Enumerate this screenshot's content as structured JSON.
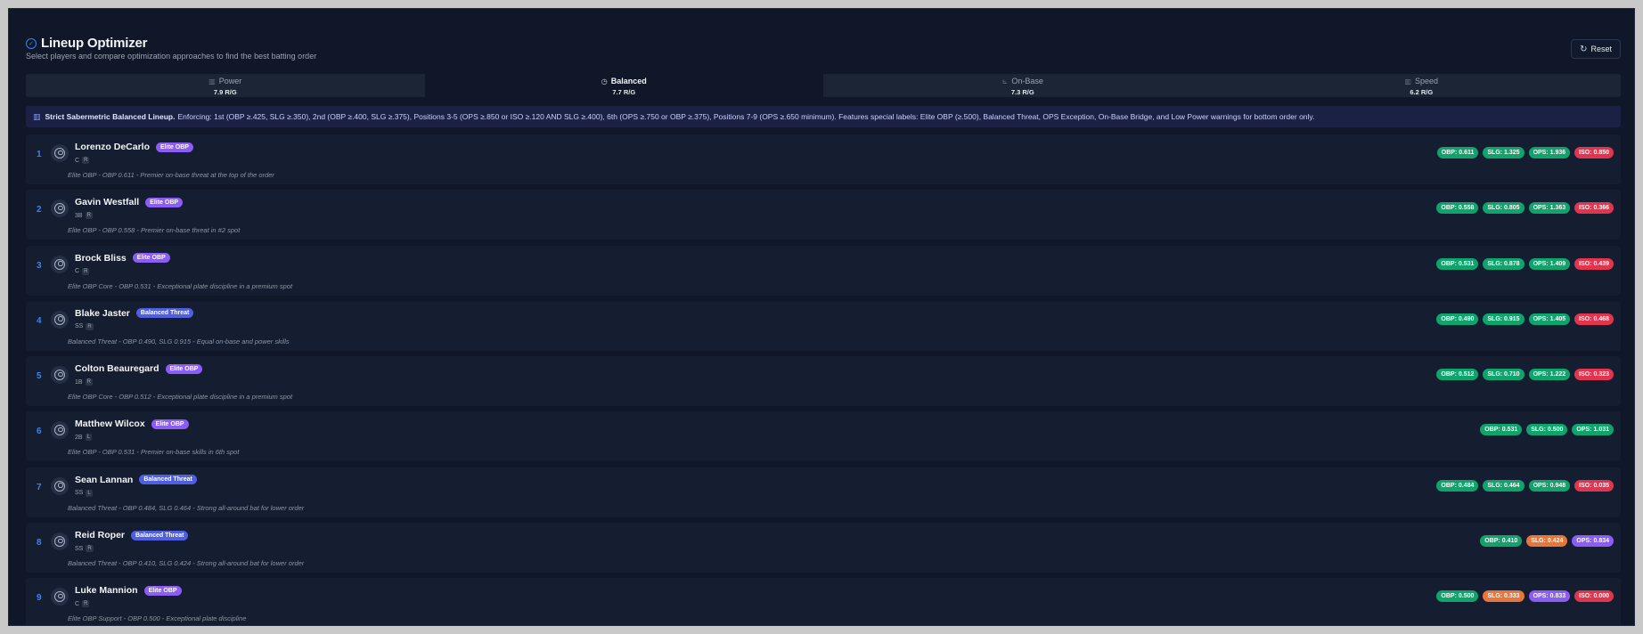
{
  "header": {
    "title": "Lineup Optimizer",
    "subtitle": "Select players and compare optimization approaches to find the best batting order",
    "reset_label": "Reset"
  },
  "tabs": [
    {
      "label": "Power",
      "runs": "7.9 R/G",
      "icon": "bar-chart-icon",
      "active": false
    },
    {
      "label": "Balanced",
      "runs": "7.7 R/G",
      "icon": "clock-icon",
      "active": true
    },
    {
      "label": "On-Base",
      "runs": "7.3 R/G",
      "icon": "line-chart-icon",
      "active": false
    },
    {
      "label": "Speed",
      "runs": "6.2 R/G",
      "icon": "bar-chart-icon",
      "active": false
    }
  ],
  "info": {
    "title": "Strict Sabermetric Balanced Lineup.",
    "text": "Enforcing: 1st (OBP ≥.425, SLG ≥.350), 2nd (OBP ≥.400, SLG ≥.375), Positions 3-5 (OPS ≥.850 or ISO ≥.120 AND SLG ≥.400), 6th (OPS ≥.750 or OBP ≥.375), Positions 7-9 (OPS ≥.650 minimum). Features special labels: Elite OBP (≥.500), Balanced Threat, OPS Exception, On-Base Bridge, and Low Power warnings for bottom order only."
  },
  "colors": {
    "green": "#10a36b",
    "red": "#e0354f",
    "orange": "#e8763a",
    "purple": "#8b5cf6",
    "elite": "#8b5cf6",
    "balanced": "#4f5fe0",
    "accent": "#3b82f6"
  },
  "players": [
    {
      "num": "1",
      "name": "Lorenzo DeCarlo",
      "tag": "Elite OBP",
      "tag_type": "elite",
      "pos": "C",
      "hand": "R",
      "note": "Elite OBP - OBP 0.611 - Premier on-base threat at the top of the order",
      "stats": [
        {
          "label": "OBP: 0.611",
          "color": "green"
        },
        {
          "label": "SLG: 1.325",
          "color": "green"
        },
        {
          "label": "OPS: 1.936",
          "color": "green"
        },
        {
          "label": "ISO: 0.850",
          "color": "red"
        }
      ]
    },
    {
      "num": "2",
      "name": "Gavin Westfall",
      "tag": "Elite OBP",
      "tag_type": "elite",
      "pos": "3B",
      "hand": "R",
      "note": "Elite OBP - OBP 0.558 - Premier on-base threat in #2 spot",
      "stats": [
        {
          "label": "OBP: 0.558",
          "color": "green"
        },
        {
          "label": "SLG: 0.805",
          "color": "green"
        },
        {
          "label": "OPS: 1.363",
          "color": "green"
        },
        {
          "label": "ISO: 0.366",
          "color": "red"
        }
      ]
    },
    {
      "num": "3",
      "name": "Brock Bliss",
      "tag": "Elite OBP",
      "tag_type": "elite",
      "pos": "C",
      "hand": "R",
      "note": "Elite OBP Core - OBP 0.531 - Exceptional plate discipline in a premium spot",
      "stats": [
        {
          "label": "OBP: 0.531",
          "color": "green"
        },
        {
          "label": "SLG: 0.878",
          "color": "green"
        },
        {
          "label": "OPS: 1.409",
          "color": "green"
        },
        {
          "label": "ISO: 0.439",
          "color": "red"
        }
      ]
    },
    {
      "num": "4",
      "name": "Blake Jaster",
      "tag": "Balanced Threat",
      "tag_type": "balanced",
      "pos": "SS",
      "hand": "R",
      "note": "Balanced Threat - OBP 0.490, SLG 0.915 - Equal on-base and power skills",
      "stats": [
        {
          "label": "OBP: 0.490",
          "color": "green"
        },
        {
          "label": "SLG: 0.915",
          "color": "green"
        },
        {
          "label": "OPS: 1.405",
          "color": "green"
        },
        {
          "label": "ISO: 0.468",
          "color": "red"
        }
      ]
    },
    {
      "num": "5",
      "name": "Colton Beauregard",
      "tag": "Elite OBP",
      "tag_type": "elite",
      "pos": "1B",
      "hand": "R",
      "note": "Elite OBP Core - OBP 0.512 - Exceptional plate discipline in a premium spot",
      "stats": [
        {
          "label": "OBP: 0.512",
          "color": "green"
        },
        {
          "label": "SLG: 0.710",
          "color": "green"
        },
        {
          "label": "OPS: 1.222",
          "color": "green"
        },
        {
          "label": "ISO: 0.323",
          "color": "red"
        }
      ]
    },
    {
      "num": "6",
      "name": "Matthew Wilcox",
      "tag": "Elite OBP",
      "tag_type": "elite",
      "pos": "2B",
      "hand": "L",
      "note": "Elite OBP - OBP 0.531 - Premier on-base skills in 6th spot",
      "stats": [
        {
          "label": "OBP: 0.531",
          "color": "green"
        },
        {
          "label": "SLG: 0.500",
          "color": "green"
        },
        {
          "label": "OPS: 1.031",
          "color": "green"
        }
      ]
    },
    {
      "num": "7",
      "name": "Sean Lannan",
      "tag": "Balanced Threat",
      "tag_type": "balanced",
      "pos": "SS",
      "hand": "L",
      "note": "Balanced Threat - OBP 0.484, SLG 0.464 - Strong all-around bat for lower order",
      "stats": [
        {
          "label": "OBP: 0.484",
          "color": "green"
        },
        {
          "label": "SLG: 0.464",
          "color": "green"
        },
        {
          "label": "OPS: 0.948",
          "color": "green"
        },
        {
          "label": "ISO: 0.035",
          "color": "red"
        }
      ]
    },
    {
      "num": "8",
      "name": "Reid Roper",
      "tag": "Balanced Threat",
      "tag_type": "balanced",
      "pos": "SS",
      "hand": "R",
      "note": "Balanced Threat - OBP 0.410, SLG 0.424 - Strong all-around bat for lower order",
      "stats": [
        {
          "label": "OBP: 0.410",
          "color": "green"
        },
        {
          "label": "SLG: 0.424",
          "color": "orange"
        },
        {
          "label": "OPS: 0.834",
          "color": "purple"
        }
      ]
    },
    {
      "num": "9",
      "name": "Luke Mannion",
      "tag": "Elite OBP",
      "tag_type": "elite",
      "pos": "C",
      "hand": "R",
      "note": "Elite OBP Support - OBP 0.500 - Exceptional plate discipline",
      "stats": [
        {
          "label": "OBP: 0.500",
          "color": "green"
        },
        {
          "label": "SLG: 0.333",
          "color": "orange"
        },
        {
          "label": "OPS: 0.833",
          "color": "purple"
        },
        {
          "label": "ISO: 0.000",
          "color": "red"
        }
      ]
    }
  ]
}
